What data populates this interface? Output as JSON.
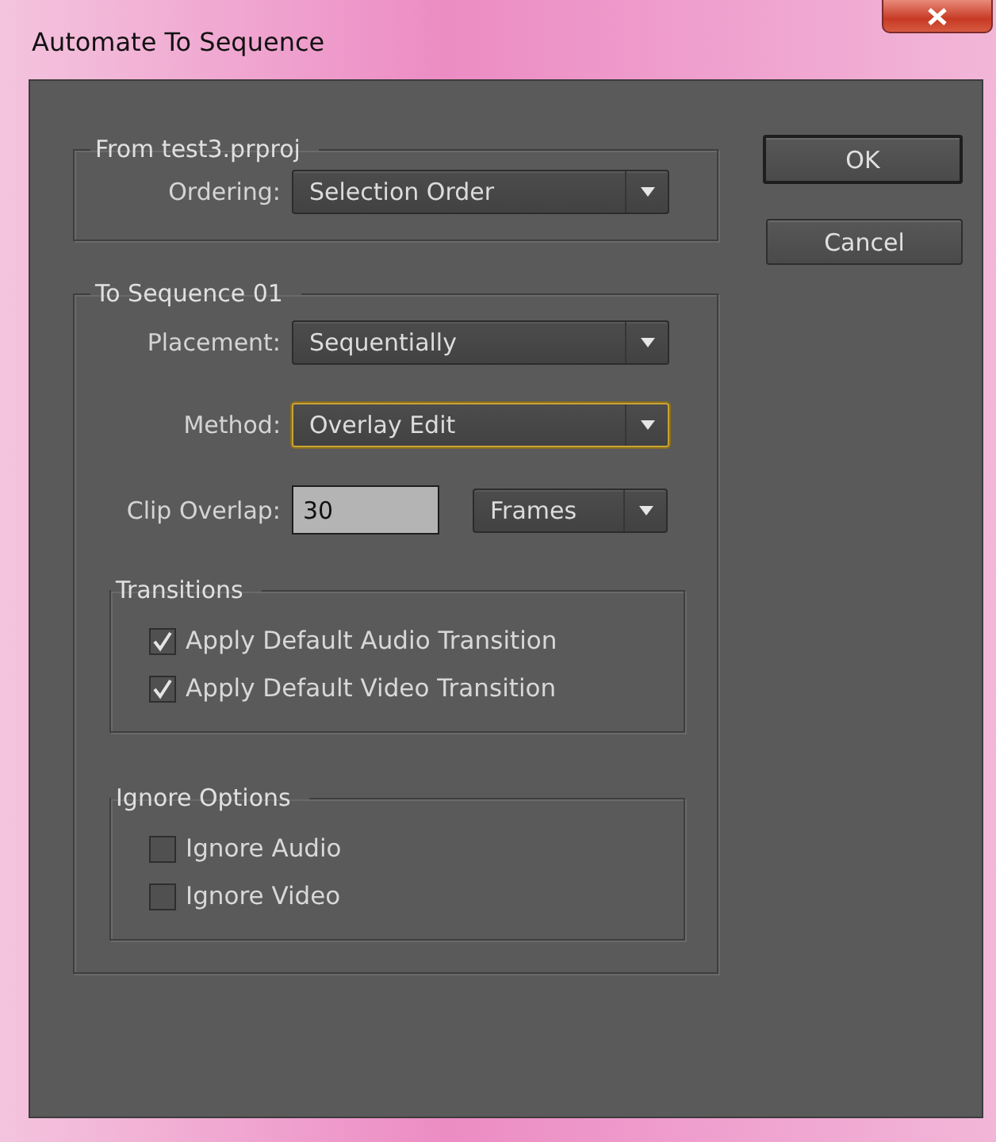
{
  "window": {
    "title": "Automate To Sequence"
  },
  "from_group": {
    "title": "From test3.prproj",
    "fields": [
      {
        "kind": "dropdown",
        "label": "Ordering:",
        "value": "Selection Order",
        "focused": false
      }
    ]
  },
  "to_group": {
    "title": "To Sequence 01",
    "fields": [
      {
        "kind": "dropdown",
        "label": "Placement:",
        "value": "Sequentially",
        "focused": false
      },
      {
        "kind": "dropdown",
        "label": "Method:",
        "value": "Overlay Edit",
        "focused": true
      },
      {
        "kind": "input_with_unit",
        "label": "Clip Overlap:",
        "value": "30",
        "unit": "Frames"
      }
    ],
    "subgroups": [
      {
        "title": "Transitions",
        "options": [
          {
            "label": "Apply Default Audio Transition",
            "checked": true
          },
          {
            "label": "Apply Default Video Transition",
            "checked": true
          }
        ]
      },
      {
        "title": "Ignore Options",
        "options": [
          {
            "label": "Ignore Audio",
            "checked": false
          },
          {
            "label": "Ignore Video",
            "checked": false
          }
        ]
      }
    ]
  },
  "buttons": [
    {
      "label": "OK",
      "default": true
    },
    {
      "label": "Cancel",
      "default": false
    }
  ]
}
